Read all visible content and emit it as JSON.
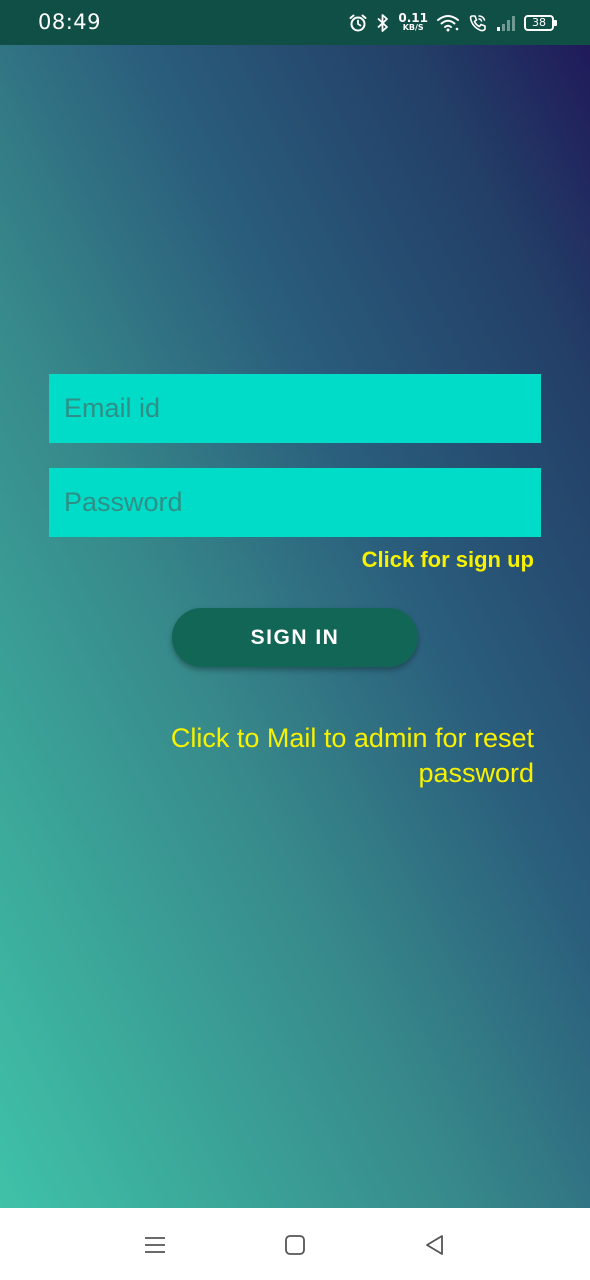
{
  "status_bar": {
    "time": "08:49",
    "net_speed_value": "0.11",
    "net_speed_unit": "KB/S",
    "battery": "38",
    "icons": [
      "alarm-icon",
      "bluetooth-icon",
      "wifi-icon",
      "wifi-call-icon",
      "signal-icon",
      "battery-icon"
    ]
  },
  "login": {
    "email_placeholder": "Email id",
    "password_placeholder": "Password",
    "signup_label": "Click for sign up",
    "signin_label": "SIGN IN",
    "reset_label": "Click to Mail to admin for reset password"
  },
  "nav_bar": {
    "icons": [
      "menu-icon",
      "home-icon",
      "back-icon"
    ]
  },
  "colors": {
    "status_bar": "#0f4f45",
    "field": "#00dcc8",
    "link": "#f7f200",
    "button": "#116655",
    "gradient_top": "#201a5a",
    "gradient_bottom": "#3fc2a8"
  }
}
